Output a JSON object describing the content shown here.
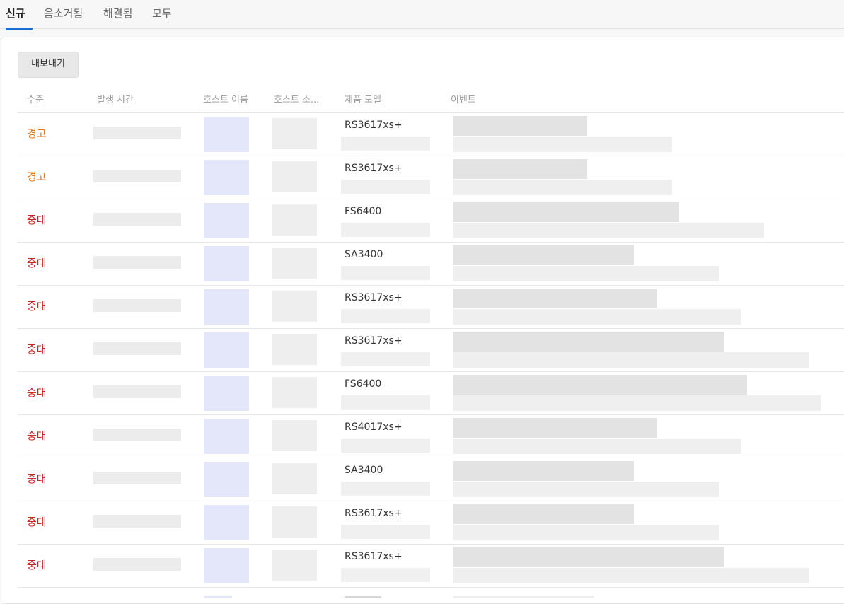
{
  "tabs": [
    {
      "label": "신규",
      "active": true
    },
    {
      "label": "음소거됨",
      "active": false
    },
    {
      "label": "해결됨",
      "active": false
    },
    {
      "label": "모두",
      "active": false
    }
  ],
  "toolbar": {
    "export_label": "내보내기"
  },
  "table": {
    "columns": [
      "수준",
      "발생 시간",
      "호스트 이름",
      "호스트 소...",
      "제품 모델",
      "이벤트"
    ],
    "rows": [
      {
        "level": "경고",
        "severity": "warning",
        "model": "RS3617xs+"
      },
      {
        "level": "경고",
        "severity": "warning",
        "model": "RS3617xs+"
      },
      {
        "level": "중대",
        "severity": "critical",
        "model": "FS6400"
      },
      {
        "level": "중대",
        "severity": "critical",
        "model": "SA3400"
      },
      {
        "level": "중대",
        "severity": "critical",
        "model": "RS3617xs+"
      },
      {
        "level": "중대",
        "severity": "critical",
        "model": "RS3617xs+"
      },
      {
        "level": "중대",
        "severity": "critical",
        "model": "FS6400"
      },
      {
        "level": "중대",
        "severity": "critical",
        "model": "RS4017xs+"
      },
      {
        "level": "중대",
        "severity": "critical",
        "model": "SA3400"
      },
      {
        "level": "중대",
        "severity": "critical",
        "model": "RS3617xs+"
      },
      {
        "level": "중대",
        "severity": "critical",
        "model": "RS3617xs+"
      }
    ]
  },
  "colors": {
    "warning": "#e07a1f",
    "critical": "#c62828",
    "active_tab_underline": "#1a6fd6"
  }
}
